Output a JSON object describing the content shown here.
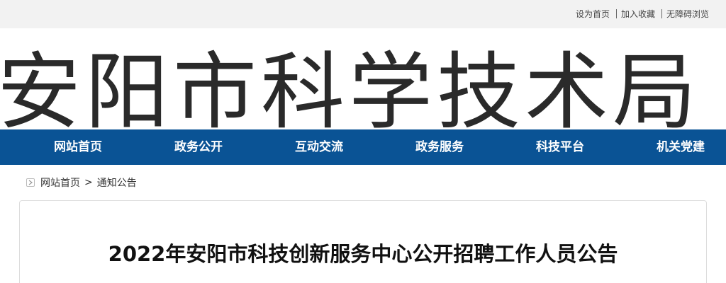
{
  "top_links": {
    "set_home": "设为首页",
    "add_favorite": "加入收藏",
    "accessibility": "无障碍浏览"
  },
  "banner": {
    "site_title": "安阳市科学技术局"
  },
  "nav": {
    "items": [
      "网站首页",
      "政务公开",
      "互动交流",
      "政务服务",
      "科技平台",
      "机关党建"
    ]
  },
  "breadcrumb": {
    "home": "网站首页",
    "separator": ">",
    "current": "通知公告"
  },
  "article": {
    "title": "2022年安阳市科技创新服务中心公开招聘工作人员公告"
  },
  "colors": {
    "nav_bg": "#0a5395",
    "topbar_bg": "#f2f2f2"
  }
}
